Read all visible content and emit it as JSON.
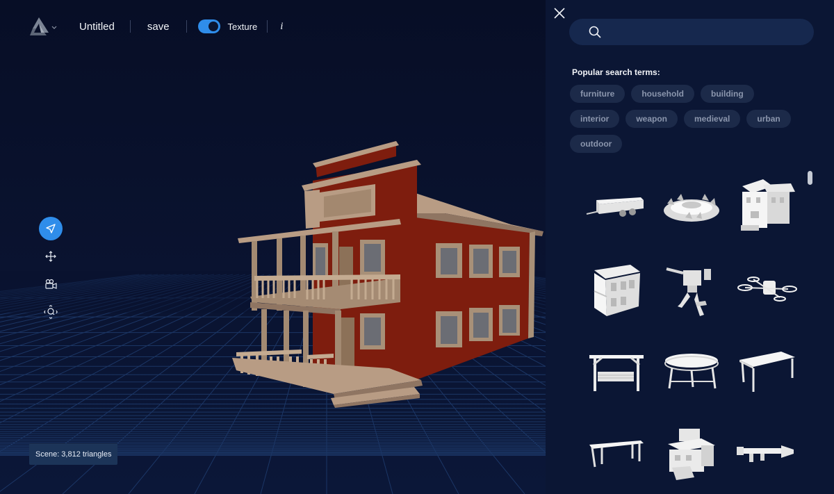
{
  "toolbar": {
    "logo_icon": "app-logo-icon",
    "title": "Untitled",
    "save_label": "save",
    "texture_label": "Texture",
    "texture_enabled": true,
    "info_label": "i"
  },
  "tools": [
    "select-arrow-icon",
    "move-arrows-icon",
    "camera-icon",
    "zoom-focus-icon"
  ],
  "scene_info": "Scene: 3,812 triangles",
  "panel": {
    "search_placeholder": "",
    "popular_label": "Popular search terms:",
    "terms": [
      "furniture",
      "household",
      "building",
      "interior",
      "weapon",
      "medieval",
      "urban",
      "outdoor"
    ],
    "results": [
      "trailer-model",
      "bear-trap-model",
      "house-model",
      "building-model",
      "robot-model",
      "drone-model",
      "swing-model",
      "round-table-model",
      "table-model",
      "bench-model",
      "tower-model",
      "rocket-launcher-model"
    ]
  },
  "colors": {
    "accent": "#2f8dea",
    "panel_bg": "#0b1634",
    "chip_bg": "#1c2a49",
    "chip_text": "#8b96ad",
    "scene_bg": "#1c3458"
  }
}
